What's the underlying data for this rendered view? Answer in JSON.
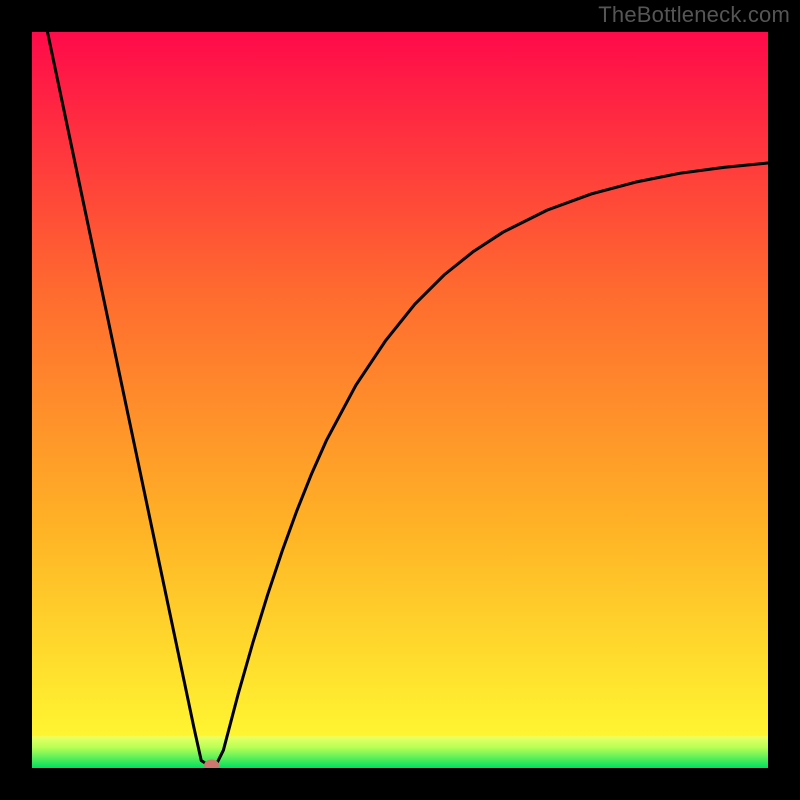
{
  "watermark": "TheBottleneck.com",
  "chart_data": {
    "type": "line",
    "title": "",
    "xlabel": "",
    "ylabel": "",
    "xlim": [
      0,
      100
    ],
    "ylim": [
      0,
      100
    ],
    "x": [
      0,
      2,
      4,
      6,
      8,
      10,
      12,
      14,
      16,
      18,
      20,
      22,
      23,
      24,
      25,
      26,
      28,
      30,
      32,
      34,
      36,
      38,
      40,
      44,
      48,
      52,
      56,
      60,
      64,
      70,
      76,
      82,
      88,
      94,
      100
    ],
    "y": [
      110,
      100.5,
      91.0,
      81.5,
      72.0,
      62.5,
      53.0,
      43.5,
      34.0,
      24.5,
      15.0,
      5.5,
      1.0,
      0.4,
      0.4,
      2.4,
      10.0,
      17.0,
      23.5,
      29.5,
      35.0,
      40.0,
      44.5,
      52.0,
      58.0,
      63.0,
      67.0,
      70.2,
      72.8,
      75.8,
      78.0,
      79.6,
      80.8,
      81.6,
      82.2
    ],
    "marker": {
      "x": 24.4,
      "y": 0.4
    },
    "background": {
      "gradient_top_color": "#ff0a4a",
      "gradient_bottom_color": "#ffff33",
      "green_zone": {
        "y_start": 0,
        "y_end": 4.3,
        "top_color": "#ecff66",
        "bottom_color": "#00e060"
      }
    }
  },
  "colors": {
    "frame": "#000000",
    "curve": "#000000",
    "marker": "#cc7770"
  }
}
